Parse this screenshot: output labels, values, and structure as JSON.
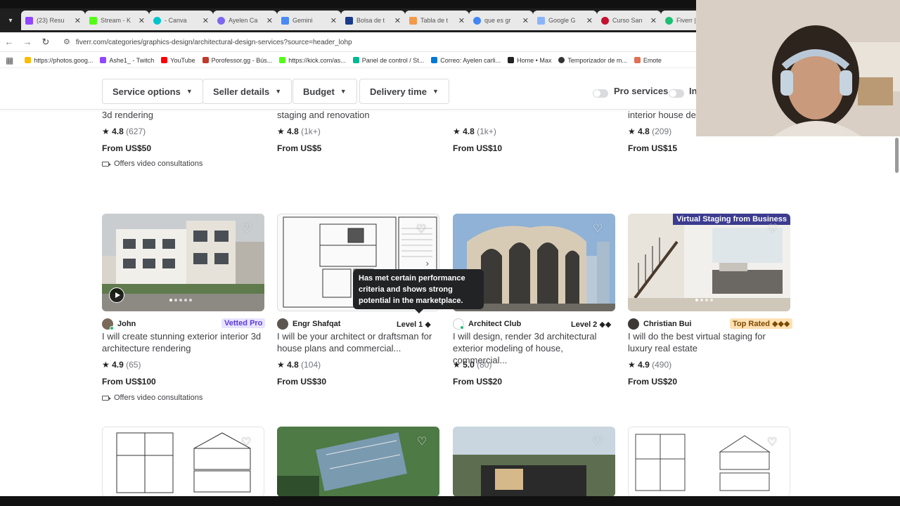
{
  "browser": {
    "tabs": [
      {
        "title": "(23) Resu",
        "color": "#9146ff"
      },
      {
        "title": "Stream - K",
        "color": "#53fc18"
      },
      {
        "title": "- Canva",
        "color": "#00c4cc"
      },
      {
        "title": "Ayelen Ca",
        "color": "#7b68ee"
      },
      {
        "title": "Gemini",
        "color": "#4a8af4"
      },
      {
        "title": "Bolsa de t",
        "color": "#1a3a8a"
      },
      {
        "title": "Tabla de t",
        "color": "#f2994a"
      },
      {
        "title": "que es gr",
        "color": "#4285f4"
      },
      {
        "title": "Google G",
        "color": "#8ab4f8"
      },
      {
        "title": "Curso San",
        "color": "#c4122f"
      },
      {
        "title": "Fiverr |",
        "color": "#1dbf73"
      }
    ],
    "url": "fiverr.com/categories/graphics-design/architectural-design-services?source=header_lohp",
    "bookmarks": [
      {
        "label": "https://photos.goog...",
        "color": "#fbbc05"
      },
      {
        "label": "Ashe1_ - Twitch",
        "color": "#9146ff"
      },
      {
        "label": "YouTube",
        "color": "#ff0000"
      },
      {
        "label": "Porofessor.gg - Bús...",
        "color": "#c0392b"
      },
      {
        "label": "https://kick.com/as...",
        "color": "#53fc18"
      },
      {
        "label": "Panel de control / St...",
        "color": "#00b894"
      },
      {
        "label": "Correo: Ayelen carli...",
        "color": "#0078d4"
      },
      {
        "label": "Home • Max",
        "color": "#222222"
      },
      {
        "label": "Temporizador de m...",
        "color": "#333333"
      },
      {
        "label": "Emote",
        "color": "#e17055"
      }
    ]
  },
  "filters": {
    "service_options": "Service options",
    "seller_details": "Seller details",
    "budget": "Budget",
    "delivery_time": "Delivery time",
    "pro_services": "Pro services",
    "instant": "In"
  },
  "top_row": [
    {
      "title_tail": "3d rendering",
      "rating": "4.8",
      "count": "(627)",
      "price": "From US$50",
      "video": "Offers video consultations"
    },
    {
      "title_tail": "staging and renovation",
      "rating": "4.8",
      "count": "(1k+)",
      "price": "From US$5"
    },
    {
      "title_tail": "",
      "rating": "4.8",
      "count": "(1k+)",
      "price": "From US$10"
    },
    {
      "title_tail": "interior house de",
      "rating": "4.8",
      "count": "(209)",
      "price": "From US$15"
    }
  ],
  "gigs": [
    {
      "seller": "John",
      "badge": "Vetted Pro",
      "title": "I will create stunning exterior interior 3d architecture rendering",
      "rating": "4.9",
      "count": "(65)",
      "price": "From US$100",
      "video": "Offers video consultations"
    },
    {
      "seller": "Engr Shafqat",
      "level": "Level 1 ◆",
      "title": "I will be your architect or draftsman for house plans and commercial...",
      "rating": "4.8",
      "count": "(104)",
      "price": "From US$30"
    },
    {
      "seller": "Architect Club",
      "level": "Level 2 ◆◆",
      "title": "I will design, render 3d architectural exterior modeling of house, commercial...",
      "rating": "5.0",
      "count": "(80)",
      "price": "From US$20"
    },
    {
      "seller": "Christian Bui",
      "badge": "Top Rated ◆◆◆",
      "ribbon": "Virtual Staging from Business",
      "title": "I will do the best virtual staging for luxury real estate",
      "rating": "4.9",
      "count": "(490)",
      "price": "From US$20"
    }
  ],
  "tooltip": "Has met certain performance criteria and shows strong potential in the marketplace.",
  "icons": {
    "star": "★",
    "heart": "♡"
  }
}
